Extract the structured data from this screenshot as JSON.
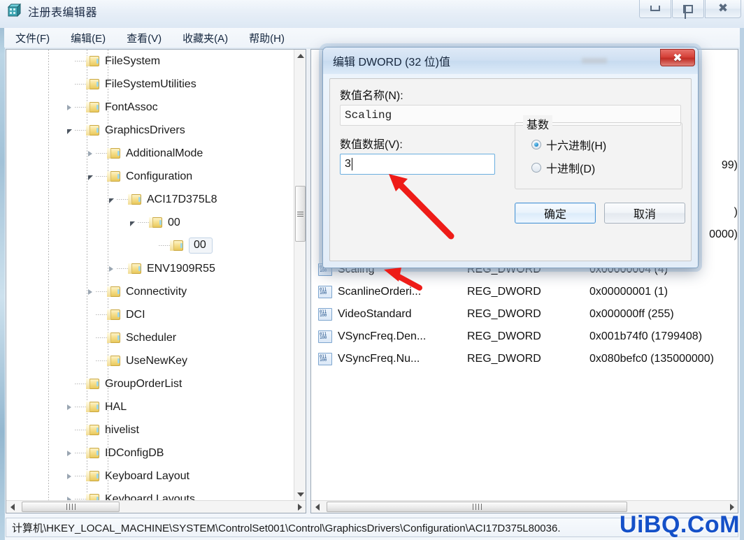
{
  "window": {
    "title": "注册表编辑器",
    "app_icon": "registry-editor-icon",
    "buttons": {
      "minimize": "minimize-icon",
      "restore": "restore-icon",
      "close": "close-icon"
    }
  },
  "menu": [
    {
      "label": "文件(F)"
    },
    {
      "label": "编辑(E)"
    },
    {
      "label": "查看(V)"
    },
    {
      "label": "收藏夹(A)"
    },
    {
      "label": "帮助(H)"
    }
  ],
  "tree": [
    {
      "label": "FileSystem",
      "indent": 2,
      "expander": "none",
      "selected": false
    },
    {
      "label": "FileSystemUtilities",
      "indent": 2,
      "expander": "none",
      "selected": false
    },
    {
      "label": "FontAssoc",
      "indent": 2,
      "expander": "collapsed",
      "selected": false
    },
    {
      "label": "GraphicsDrivers",
      "indent": 2,
      "expander": "expanded",
      "selected": false
    },
    {
      "label": "AdditionalMode",
      "indent": 3,
      "expander": "collapsed",
      "selected": false
    },
    {
      "label": "Configuration",
      "indent": 3,
      "expander": "expanded",
      "selected": false
    },
    {
      "label": "ACI17D375L8",
      "indent": 4,
      "expander": "expanded",
      "selected": false
    },
    {
      "label": "00",
      "indent": 5,
      "expander": "expanded",
      "selected": false
    },
    {
      "label": "00",
      "indent": 6,
      "expander": "none",
      "selected": true
    },
    {
      "label": "ENV1909R55",
      "indent": 4,
      "expander": "collapsed",
      "selected": false
    },
    {
      "label": "Connectivity",
      "indent": 3,
      "expander": "collapsed",
      "selected": false
    },
    {
      "label": "DCI",
      "indent": 3,
      "expander": "none",
      "selected": false
    },
    {
      "label": "Scheduler",
      "indent": 3,
      "expander": "none",
      "selected": false
    },
    {
      "label": "UseNewKey",
      "indent": 3,
      "expander": "none",
      "selected": false
    },
    {
      "label": "GroupOrderList",
      "indent": 2,
      "expander": "none",
      "selected": false
    },
    {
      "label": "HAL",
      "indent": 2,
      "expander": "collapsed",
      "selected": false
    },
    {
      "label": "hivelist",
      "indent": 2,
      "expander": "none",
      "selected": false
    },
    {
      "label": "IDConfigDB",
      "indent": 2,
      "expander": "collapsed",
      "selected": false
    },
    {
      "label": "Keyboard Layout",
      "indent": 2,
      "expander": "collapsed",
      "selected": false
    },
    {
      "label": "Keyboard Layouts",
      "indent": 2,
      "expander": "collapsed",
      "selected": false
    }
  ],
  "values": {
    "occluded_rows": [
      {
        "data": "99)"
      },
      {
        "data": ")"
      },
      {
        "data": "0000)"
      }
    ],
    "rows": [
      {
        "name": "Scaling",
        "type": "REG_DWORD",
        "data": "0x00000004 (4)"
      },
      {
        "name": "ScanlineOrderi...",
        "type": "REG_DWORD",
        "data": "0x00000001 (1)"
      },
      {
        "name": "VideoStandard",
        "type": "REG_DWORD",
        "data": "0x000000ff (255)"
      },
      {
        "name": "VSyncFreq.Den...",
        "type": "REG_DWORD",
        "data": "0x001b74f0 (1799408)"
      },
      {
        "name": "VSyncFreq.Nu...",
        "type": "REG_DWORD",
        "data": "0x080befc0 (135000000)"
      }
    ]
  },
  "dialog": {
    "title": "编辑 DWORD (32 位)值",
    "close_icon": "close-icon",
    "name_label": "数值名称(N):",
    "name_value": "Scaling",
    "data_label": "数值数据(V):",
    "data_value": "3",
    "base_group_title": "基数",
    "radios": [
      {
        "label": "十六进制(H)",
        "checked": true
      },
      {
        "label": "十进制(D)",
        "checked": false
      }
    ],
    "ok_label": "确定",
    "cancel_label": "取消"
  },
  "statusbar": {
    "path": "计算机\\HKEY_LOCAL_MACHINE\\SYSTEM\\ControlSet001\\Control\\GraphicsDrivers\\Configuration\\ACI17D375L80036."
  },
  "watermark": {
    "text": "UiBQ.CoM"
  },
  "colors": {
    "accent_blue": "#1f86c8",
    "close_red": "#c12d25",
    "arrow_red": "#ee1c18",
    "folder_yellow": "#f6e08f",
    "watermark_blue": "#1450c8"
  }
}
